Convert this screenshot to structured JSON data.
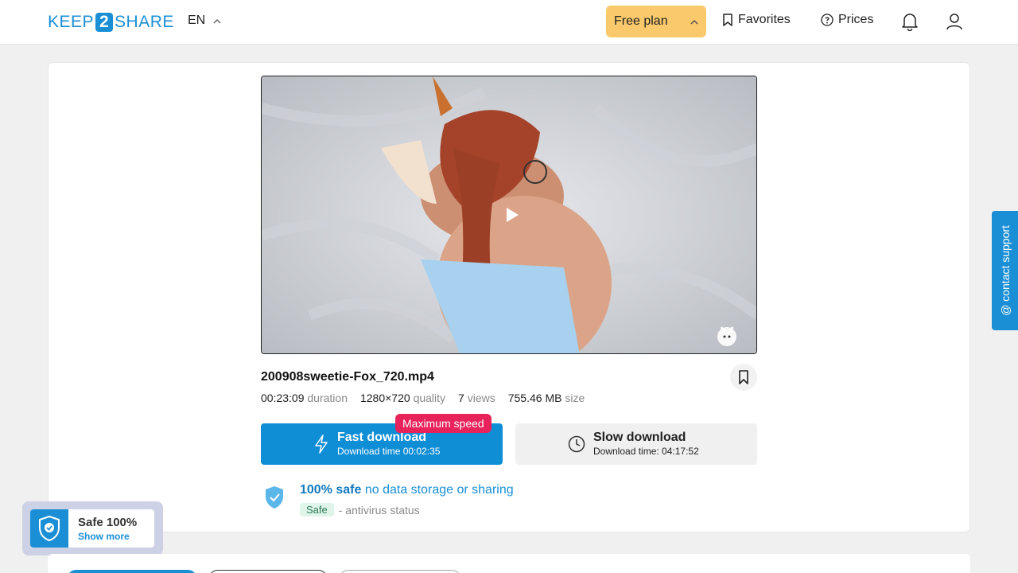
{
  "header": {
    "logo_left": "KEEP",
    "logo_mid": "2",
    "logo_right": "SHARE",
    "language": "EN",
    "plan_label": "Free plan",
    "favorites_label": "Favorites",
    "prices_label": "Prices"
  },
  "file": {
    "name": "200908sweetie-Fox_720.mp4",
    "duration": "00:23:09",
    "duration_unit": "duration",
    "quality": "1280×720",
    "quality_unit": "quality",
    "views": "7",
    "views_unit": "views",
    "size": "755.46 MB",
    "size_unit": "size"
  },
  "download": {
    "fast_label": "Fast download",
    "fast_time": "Download time 00:02:35",
    "badge": "Maximum speed",
    "slow_label": "Slow download",
    "slow_time": "Download time: 04:17:52"
  },
  "safety": {
    "headline_bold": "100% safe",
    "headline_rest": "no data storage or sharing",
    "status_pill": "Safe",
    "status_text": "- antivirus status"
  },
  "support": {
    "label": "@ contact support"
  },
  "safe_float": {
    "title": "Safe 100%",
    "link": "Show more"
  },
  "colors": {
    "accent": "#1a8fd6",
    "plan": "#f9c96b",
    "badge": "#e8225a"
  }
}
